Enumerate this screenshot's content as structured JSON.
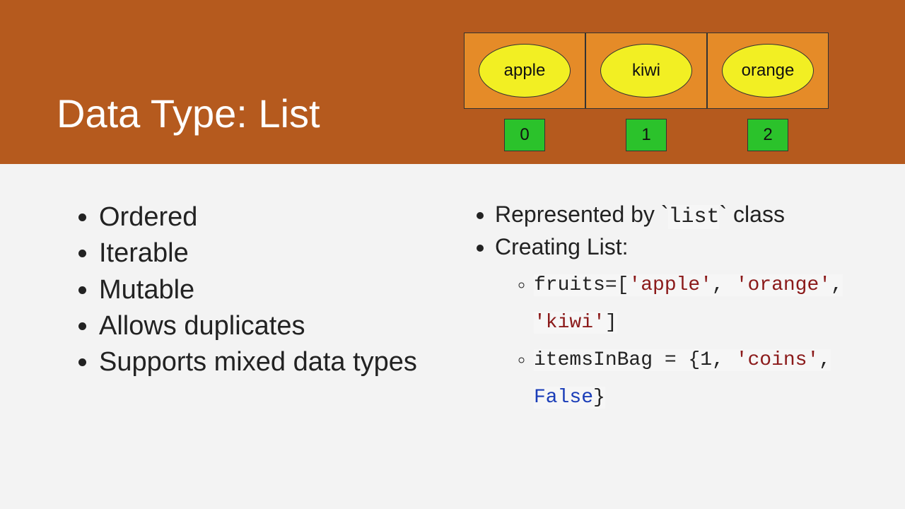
{
  "title": "Data Type: List",
  "diagram": {
    "cells": [
      "apple",
      "kiwi",
      "orange"
    ],
    "indices": [
      "0",
      "1",
      "2"
    ]
  },
  "left_bullets": [
    "Ordered",
    "Iterable",
    "Mutable",
    "Allows duplicates",
    "Supports mixed data types"
  ],
  "right": {
    "rep_prefix": "Represented by `",
    "rep_code": "list",
    "rep_suffix": "` class",
    "creating_label": "Creating List:",
    "ex1": {
      "a": "fruits=[",
      "s1": "'apple'",
      "c1": ", ",
      "s2": "'orange'",
      "c2": ", ",
      "s3": "'kiwi'",
      "z": "]"
    },
    "ex2": {
      "a": "itemsInBag = {",
      "n1": "1",
      "c1": ", ",
      "s1": "'coins'",
      "c2": ", ",
      "k1": "False",
      "z": "}"
    }
  }
}
